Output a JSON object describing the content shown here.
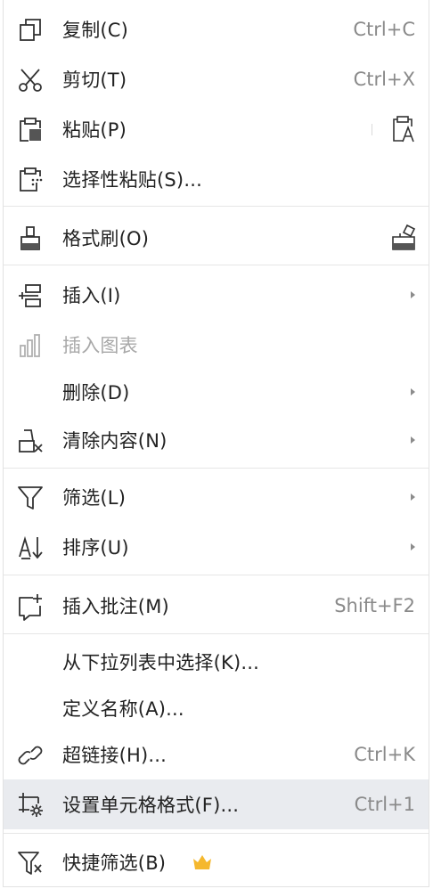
{
  "menu": {
    "copy": {
      "label": "复制(C)",
      "shortcut": "Ctrl+C",
      "icon": "copy-icon"
    },
    "cut": {
      "label": "剪切(T)",
      "shortcut": "Ctrl+X",
      "icon": "scissors-icon"
    },
    "paste": {
      "label": "粘贴(P)",
      "icon": "clipboard-icon",
      "right_icon": "paste-text-only-icon"
    },
    "paste_special": {
      "label": "选择性粘贴(S)...",
      "icon": "paste-special-icon"
    },
    "format_painter": {
      "label": "格式刷(O)",
      "icon": "format-brush-icon",
      "right_icon": "multi-brush-icon"
    },
    "insert": {
      "label": "插入(I)",
      "icon": "insert-icon"
    },
    "insert_chart": {
      "label": "插入图表",
      "icon": "chart-icon",
      "disabled": true
    },
    "delete": {
      "label": "删除(D)"
    },
    "clear_contents": {
      "label": "清除内容(N)",
      "icon": "eraser-icon"
    },
    "filter": {
      "label": "筛选(L)",
      "icon": "filter-icon"
    },
    "sort": {
      "label": "排序(U)",
      "icon": "sort-icon"
    },
    "insert_comment": {
      "label": "插入批注(M)",
      "shortcut": "Shift+F2",
      "icon": "comment-add-icon"
    },
    "pick_from_list": {
      "label": "从下拉列表中选择(K)..."
    },
    "define_name": {
      "label": "定义名称(A)..."
    },
    "hyperlink": {
      "label": "超链接(H)...",
      "shortcut": "Ctrl+K",
      "icon": "link-icon"
    },
    "format_cells": {
      "label": "设置单元格格式(F)...",
      "shortcut": "Ctrl+1",
      "icon": "cell-format-gear-icon",
      "highlighted": true
    },
    "quick_filter": {
      "label": "快捷筛选(B)",
      "icon": "quick-filter-icon",
      "badge_icon": "crown-icon"
    }
  },
  "colors": {
    "text": "#222222",
    "shortcut": "#8a8a8a",
    "disabled": "#a8a8a8",
    "highlight": "#e9ebef",
    "crown": "#f5b82e"
  }
}
